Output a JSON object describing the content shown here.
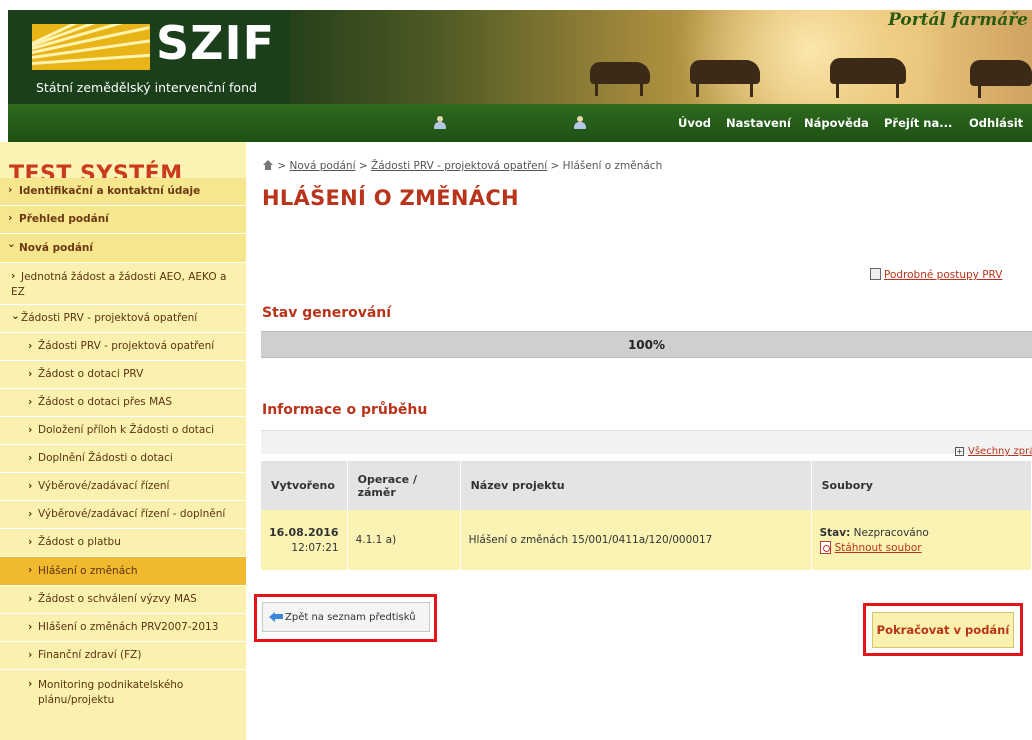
{
  "header": {
    "logo_text": "SZIF",
    "logo_subtitle": "Státní zemědělský intervenční fond",
    "portal_title": "Portál farmáře"
  },
  "nav": {
    "items": [
      {
        "label": "Úvod"
      },
      {
        "label": "Nastavení"
      },
      {
        "label": "Nápověda"
      },
      {
        "label": "Přejít na..."
      },
      {
        "label": "Odhlásit"
      }
    ],
    "icons": [
      "user-icon",
      "user-icon"
    ]
  },
  "sidebar": {
    "system_title": "TEST SYSTÉM",
    "items": [
      {
        "label": "Identifikační a kontaktní údaje",
        "chev": "›"
      },
      {
        "label": "Přehled podání",
        "chev": "›"
      },
      {
        "label": "Nová podání",
        "chev": "⌄"
      },
      {
        "label": "Jednotná žádost a žádosti AEO, AEKO a EZ",
        "chev": "›"
      },
      {
        "label": "Žádosti PRV - projektová opatření",
        "chev": "⌄"
      },
      {
        "label": "Žádosti PRV - projektová opatření",
        "chev": "›"
      },
      {
        "label": "Žádost o dotaci PRV",
        "chev": "›"
      },
      {
        "label": "Žádost o dotaci přes MAS",
        "chev": "›"
      },
      {
        "label": "Doložení příloh k Žádosti o dotaci",
        "chev": "›"
      },
      {
        "label": "Doplnění Žádosti o dotaci",
        "chev": "›"
      },
      {
        "label": "Výběrové/zadávací řízení",
        "chev": "›"
      },
      {
        "label": "Výběrové/zadávací řízení - doplnění",
        "chev": "›"
      },
      {
        "label": "Žádost o platbu",
        "chev": "›"
      },
      {
        "label": "Hlášení o změnách",
        "chev": "›"
      },
      {
        "label": "Žádost o schválení výzvy MAS",
        "chev": "›"
      },
      {
        "label": "Hlášení o změnách PRV2007-2013",
        "chev": "›"
      },
      {
        "label": "Finanční zdraví (FZ)",
        "chev": "›"
      },
      {
        "label": "Monitoring podnikatelského plánu/projektu",
        "chev": "›"
      }
    ]
  },
  "breadcrumb": {
    "sep": " > ",
    "items": [
      "Nová podání",
      "Žádosti PRV - projektová opatření"
    ],
    "current": "Hlášení o změnách"
  },
  "main": {
    "title": "HLÁŠENÍ O ZMĚNÁCH",
    "detail_link": "Podrobné postupy PRV",
    "status_heading": "Stav generování",
    "progress": {
      "percent": 100,
      "label": "100%"
    },
    "info_heading": "Informace o průběhu",
    "all_messages": "Všechny zprávy",
    "table": {
      "headers": [
        "Vytvořeno",
        "Operace / záměr",
        "Název projektu",
        "Soubory"
      ],
      "rows": [
        {
          "date": "16.08.2016",
          "time": "12:07:21",
          "operation": "4.1.1 a)",
          "project": "Hlášení o změnách 15/001/0411a/120/000017",
          "status_label": "Stav:",
          "status_value": "Nezpracováno",
          "download": "Stáhnout soubor"
        }
      ]
    },
    "back_button": "Zpět na seznam předtisků",
    "continue_button": "Pokračovat v podání"
  },
  "colors": {
    "accent": "#b8341a",
    "highlight_frame": "#e3141a",
    "nav_green": "#2d6a1e",
    "sidebar_bg": "#fbf3b4",
    "active_item": "#f0b92e"
  }
}
